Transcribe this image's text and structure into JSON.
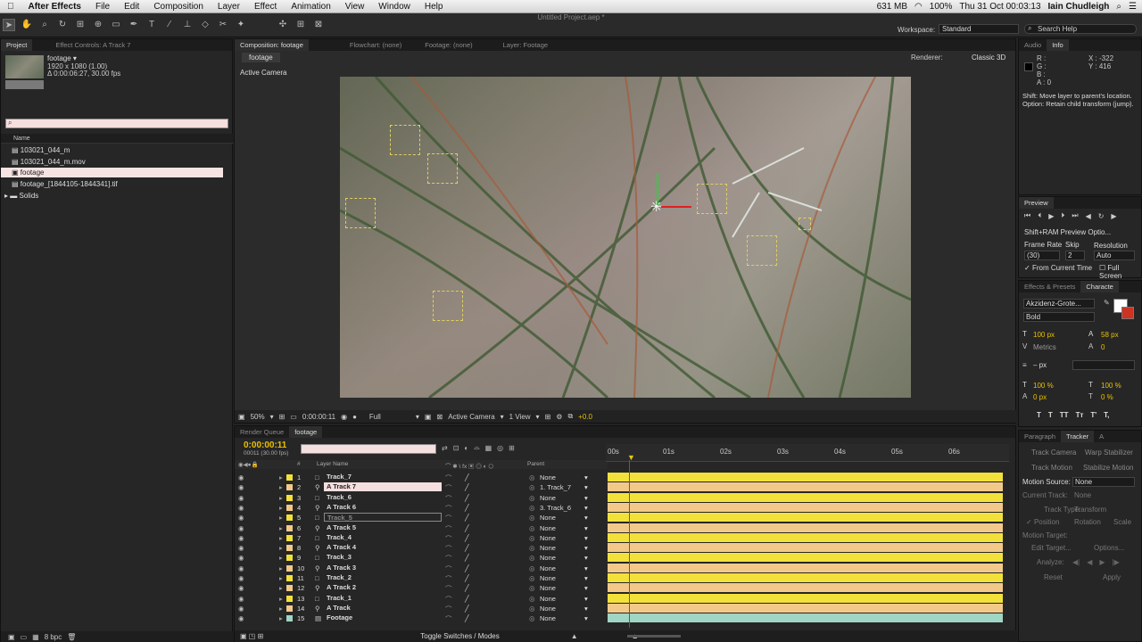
{
  "menubar": {
    "app": "After Effects",
    "items": [
      "File",
      "Edit",
      "Composition",
      "Layer",
      "Effect",
      "Animation",
      "View",
      "Window",
      "Help"
    ],
    "memory": "631 MB",
    "battery": "100%",
    "datetime": "Thu 31 Oct  00:03:13",
    "user": "Iain Chudleigh"
  },
  "toolbar": {
    "doc_title": "Untitled Project.aep *",
    "workspace_label": "Workspace:",
    "workspace_value": "Standard",
    "search_help": "Search Help"
  },
  "project": {
    "tab": "Project",
    "tab2": "Effect Controls: A Track 7",
    "item_name": "footage ▾",
    "item_dims": "1920 x 1080 (1.00)",
    "item_dur": "Δ 0:00:06:27, 30.00 fps",
    "col_name": "Name",
    "files": [
      "103021_044_m",
      "103021_044_m.mov",
      "footage",
      "footage_[1844105-1844341].tif",
      "Solids"
    ],
    "bpc": "8 bpc"
  },
  "viewer": {
    "tabs": [
      "Composition: footage",
      "Flowchart: (none)",
      "Footage: (none)",
      "Layer: Footage"
    ],
    "subtab": "footage",
    "active_camera": "Active Camera",
    "renderer_label": "Renderer:",
    "renderer": "Classic 3D",
    "zoom": "50%",
    "timecode": "0:00:00:11",
    "quality": "Full",
    "camera": "Active Camera",
    "views": "1 View",
    "exposure": "+0.0"
  },
  "info": {
    "tabs": [
      "Audio",
      "Info"
    ],
    "r": "R :",
    "g": "G :",
    "b": "B :",
    "a": "A : 0",
    "x": "X : -322",
    "y": "Y : 416",
    "msg1": "Shift: Move layer to parent's location.",
    "msg2": "Option: Retain child transform (jump)."
  },
  "preview": {
    "tab": "Preview",
    "ram_btn": "Shift+RAM Preview Optio...",
    "frame_rate_label": "Frame Rate",
    "skip_label": "Skip",
    "resolution_label": "Resolution",
    "frame_rate": "(30)",
    "skip": "2",
    "resolution": "Auto",
    "from_current": "From Current Time",
    "full_screen": "Full Screen"
  },
  "character": {
    "tabs": [
      "Effects & Presets",
      "Characte"
    ],
    "font": "Akzidenz-Grote...",
    "style": "Bold",
    "size": "100 px",
    "leading": "58 px",
    "kerning": "Metrics",
    "tracking": "0",
    "stroke": "– px",
    "vscale": "100 %",
    "hscale": "100 %",
    "baseline": "0 px",
    "tsume": "0 %"
  },
  "tracker": {
    "tabs": [
      "Paragraph",
      "Tracker",
      "A"
    ],
    "track_camera": "Track Camera",
    "warp": "Warp Stabilizer",
    "track_motion": "Track Motion",
    "stabilize": "Stabilize Motion",
    "motion_source_label": "Motion Source:",
    "motion_source": "None",
    "current_track_label": "Current Track:",
    "current_track": "None",
    "track_type_label": "Track Type:",
    "track_type": "Transform",
    "position": "Position",
    "rotation": "Rotation",
    "scale": "Scale",
    "motion_target": "Motion Target:",
    "edit_target": "Edit Target...",
    "options": "Options...",
    "analyze": "Analyze:",
    "reset": "Reset",
    "apply": "Apply"
  },
  "timeline": {
    "tabs": [
      "Render Queue",
      "footage"
    ],
    "timecode": "0:00:00:11",
    "frames": "00011 (30.00 fps)",
    "col_layer": "Layer Name",
    "col_parent": "Parent",
    "toggle": "Toggle Switches / Modes",
    "ruler": [
      "00s",
      "01s",
      "02s",
      "03s",
      "04s",
      "05s",
      "06s"
    ],
    "layers": [
      {
        "num": "1",
        "name": "Track_7",
        "parent": "None",
        "color": "#f3e13b"
      },
      {
        "num": "2",
        "name": "A Track 7",
        "parent": "1. Track_7",
        "color": "#f3c98a"
      },
      {
        "num": "3",
        "name": "Track_6",
        "parent": "None",
        "color": "#f3e13b"
      },
      {
        "num": "4",
        "name": "A Track 6",
        "parent": "3. Track_6",
        "color": "#f3c98a"
      },
      {
        "num": "5",
        "name": "Track_5",
        "parent": "None",
        "color": "#f3e13b"
      },
      {
        "num": "6",
        "name": "A Track 5",
        "parent": "None",
        "color": "#f3c98a"
      },
      {
        "num": "7",
        "name": "Track_4",
        "parent": "None",
        "color": "#f3e13b"
      },
      {
        "num": "8",
        "name": "A Track 4",
        "parent": "None",
        "color": "#f3c98a"
      },
      {
        "num": "9",
        "name": "Track_3",
        "parent": "None",
        "color": "#f3e13b"
      },
      {
        "num": "10",
        "name": "A Track 3",
        "parent": "None",
        "color": "#f3c98a"
      },
      {
        "num": "11",
        "name": "Track_2",
        "parent": "None",
        "color": "#f3e13b"
      },
      {
        "num": "12",
        "name": "A Track 2",
        "parent": "None",
        "color": "#f3c98a"
      },
      {
        "num": "13",
        "name": "Track_1",
        "parent": "None",
        "color": "#f3e13b"
      },
      {
        "num": "14",
        "name": "A Track",
        "parent": "None",
        "color": "#f3c98a"
      },
      {
        "num": "15",
        "name": "Footage",
        "parent": "None",
        "color": "#9fd6c4"
      }
    ]
  }
}
